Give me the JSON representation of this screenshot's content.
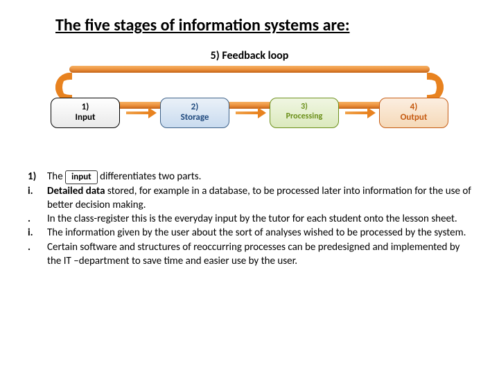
{
  "title": "The five stages of information systems are:",
  "feedback_label": "5) Feedback  loop",
  "stages": [
    {
      "line1": "1)",
      "line2": "Input"
    },
    {
      "line1": "2)",
      "line2": "Storage"
    },
    {
      "line1": "3)",
      "line2": "Processing"
    },
    {
      "line1": "4)",
      "line2": "Output"
    }
  ],
  "body": {
    "n1": "1)",
    "l1a": "The",
    "pill": "input",
    "l1b": "differentiates two parts.",
    "bi": "i.",
    "bdot": ".",
    "p_i_1a": "Detailed data",
    "p_i_1b": " stored, for example in a database, to be processed later into information for the use of better decision making.",
    "p_i_1c": "In the class-register this is the everyday input by the tutor for each student onto the lesson sheet.",
    "p_i_2a": "The information given by the user about the sort of analyses wished to be processed by the system.",
    "p_i_2b": "Certain software and structures of reoccurring processes can be predesigned and implemented by the IT –department to save time and easier use by the user."
  }
}
